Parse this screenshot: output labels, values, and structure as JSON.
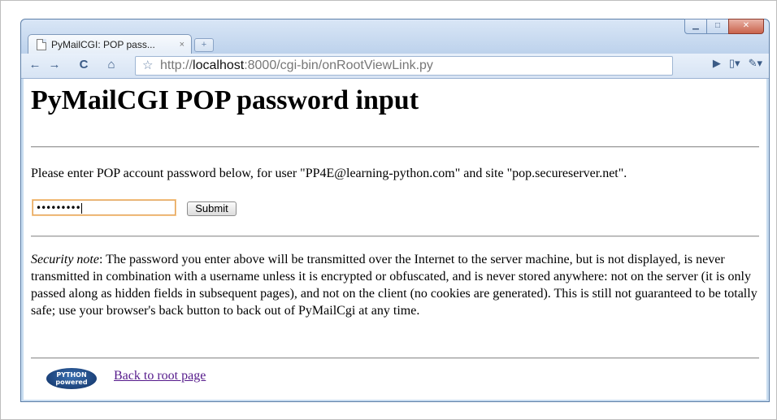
{
  "browser": {
    "tab_title": "PyMailCGI: POP pass...",
    "tab_close": "×",
    "new_tab": "+",
    "url_prefix": "http://",
    "url_host": "localhost",
    "url_rest": ":8000/cgi-bin/onRootViewLink.py",
    "icons": [
      "back-icon",
      "forward-icon",
      "reload-icon",
      "home-icon",
      "star-icon",
      "play-icon",
      "page-menu-icon",
      "wrench-icon"
    ]
  },
  "page": {
    "heading": "PyMailCGI POP password input",
    "prompt": "Please enter POP account password below, for user \"PP4E@learning-python.com\" and site \"pop.secureserver.net\".",
    "password_value": "•••••••••",
    "submit_label": "Submit",
    "note_label": "Security note",
    "note_text": ": The password you enter above will be transmitted over the Internet to the server machine, but is not displayed, is never transmitted in combination with a username unless it is encrypted or obfuscated, and is never stored anywhere: not on the server (it is only passed along as hidden fields in subsequent pages), and not on the client (no cookies are generated). This is still not guaranteed to be totally safe; use your browser's back button to back out of PyMailCgi at any time.",
    "badge_line1": "PYTHON",
    "badge_line2": "powered",
    "back_link": "Back to root page"
  }
}
